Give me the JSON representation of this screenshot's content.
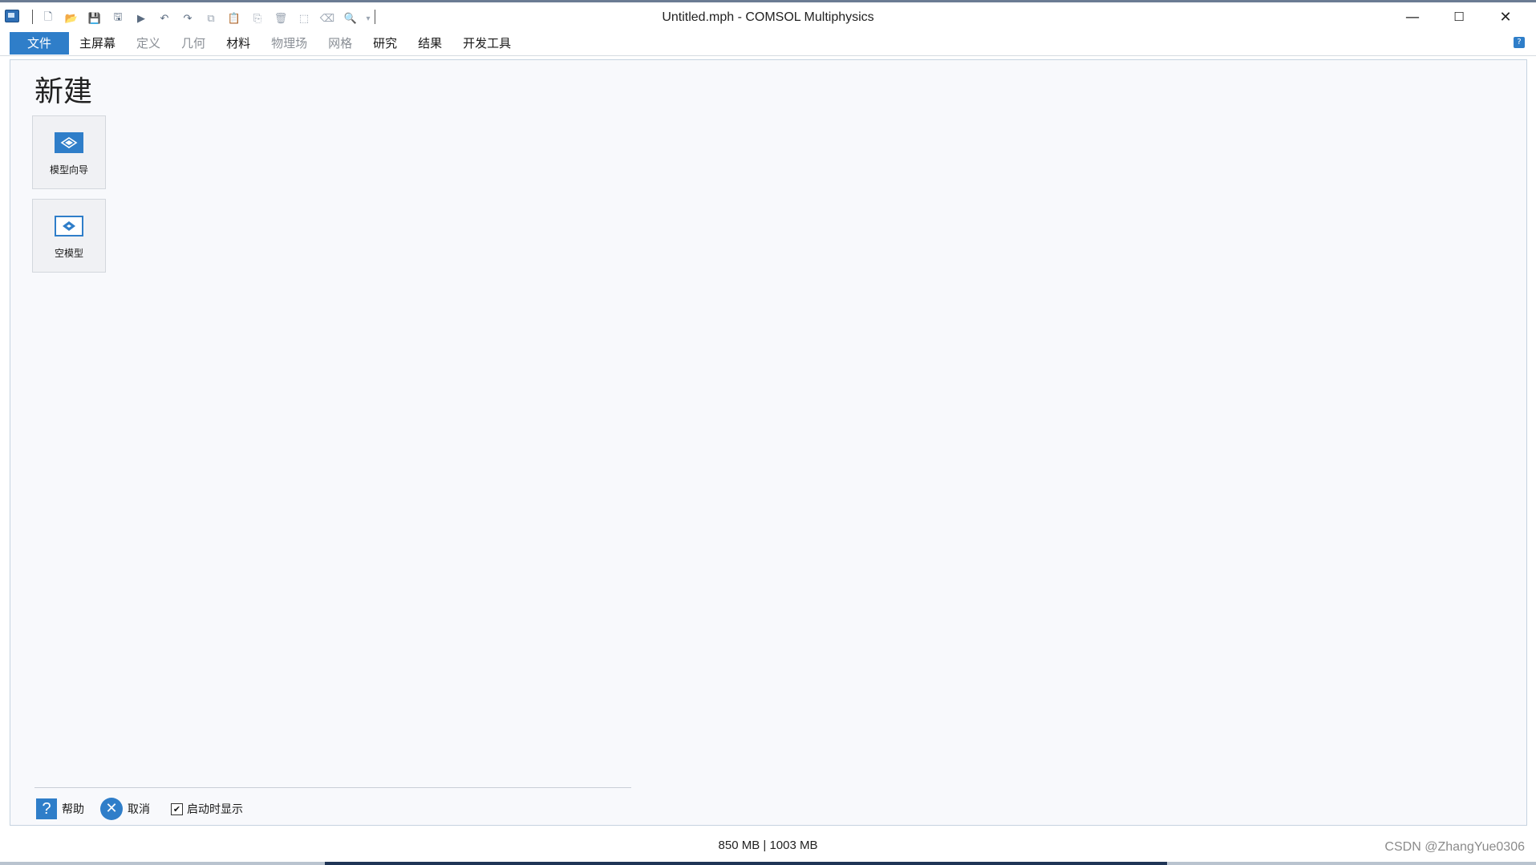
{
  "window": {
    "title": "Untitled.mph - COMSOL Multiphysics",
    "controls": {
      "minimize": "—",
      "maximize": "☐",
      "close": "✕"
    }
  },
  "quick_access": [
    {
      "name": "new-file-icon",
      "glyph": "🗋"
    },
    {
      "name": "open-folder-icon",
      "glyph": "📂"
    },
    {
      "name": "save-icon",
      "glyph": "💾"
    },
    {
      "name": "save-as-icon",
      "glyph": "🖫"
    },
    {
      "name": "run-icon",
      "glyph": "▶"
    },
    {
      "name": "undo-icon",
      "glyph": "↶"
    },
    {
      "name": "redo-icon",
      "glyph": "↷"
    },
    {
      "name": "copy-icon",
      "glyph": "⧉"
    },
    {
      "name": "paste-icon",
      "glyph": "📋"
    },
    {
      "name": "duplicate-icon",
      "glyph": "⎘"
    },
    {
      "name": "delete-icon",
      "glyph": "🗑"
    },
    {
      "name": "select-icon",
      "glyph": "⬚"
    },
    {
      "name": "clear-icon",
      "glyph": "⌫"
    },
    {
      "name": "zoom-icon",
      "glyph": "🔍"
    },
    {
      "name": "customize-dropdown-icon",
      "glyph": "▾"
    }
  ],
  "ribbon": {
    "tabs": [
      {
        "label": "文件",
        "state": "active"
      },
      {
        "label": "主屏幕",
        "state": "enabled"
      },
      {
        "label": "定义",
        "state": "disabled"
      },
      {
        "label": "几何",
        "state": "disabled"
      },
      {
        "label": "材料",
        "state": "enabled"
      },
      {
        "label": "物理场",
        "state": "disabled"
      },
      {
        "label": "网格",
        "state": "disabled"
      },
      {
        "label": "研究",
        "state": "enabled"
      },
      {
        "label": "结果",
        "state": "enabled"
      },
      {
        "label": "开发工具",
        "state": "enabled"
      }
    ],
    "help_glyph": "?"
  },
  "panel": {
    "title": "新建",
    "tiles": [
      {
        "label": "模型向导",
        "icon": "model-wizard-icon"
      },
      {
        "label": "空模型",
        "icon": "blank-model-icon"
      }
    ],
    "footer": {
      "help_label": "帮助",
      "help_glyph": "?",
      "cancel_label": "取消",
      "cancel_glyph": "✕",
      "show_on_startup_label": "启动时显示",
      "show_on_startup_checked": true,
      "check_glyph": "✔"
    }
  },
  "status": {
    "memory": "850 MB | 1003 MB",
    "watermark": "CSDN @ZhangYue0306"
  },
  "colors": {
    "accent": "#2f7ec9",
    "panel_bg": "#f8f9fc",
    "disabled_text": "#8a8f96"
  }
}
